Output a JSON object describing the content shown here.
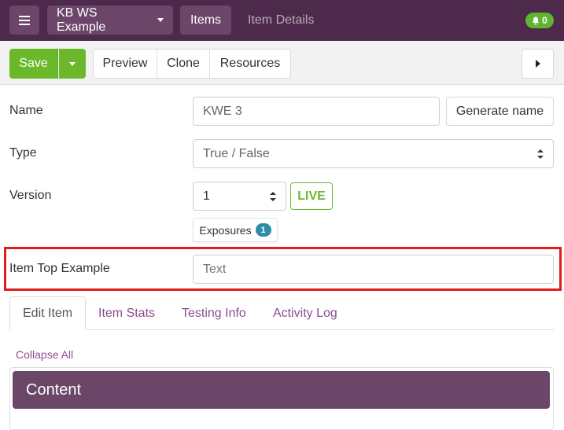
{
  "nav": {
    "workspace_label": "KB WS Example",
    "items_label": "Items",
    "item_details_label": "Item Details",
    "notification_count": "0"
  },
  "toolbar": {
    "save_label": "Save",
    "preview_label": "Preview",
    "clone_label": "Clone",
    "resources_label": "Resources"
  },
  "form": {
    "name_label": "Name",
    "name_value": "KWE 3",
    "generate_name_label": "Generate name",
    "type_label": "Type",
    "type_value": "True / False",
    "version_label": "Version",
    "version_value": "1",
    "live_label": "LIVE",
    "exposures_label": "Exposures",
    "exposures_count": "1",
    "item_top_label": "Item Top Example",
    "item_top_placeholder": "Text"
  },
  "tabs": [
    {
      "label": "Edit Item"
    },
    {
      "label": "Item Stats"
    },
    {
      "label": "Testing Info"
    },
    {
      "label": "Activity Log"
    }
  ],
  "collapse_all_label": "Collapse All",
  "content_header": "Content",
  "colors": {
    "nav_bg": "#4d2a4b",
    "accent_purple": "#6c4669",
    "save_green": "#6bb82b",
    "highlight_red": "#e31b1b",
    "link_purple": "#8e4b8e"
  }
}
